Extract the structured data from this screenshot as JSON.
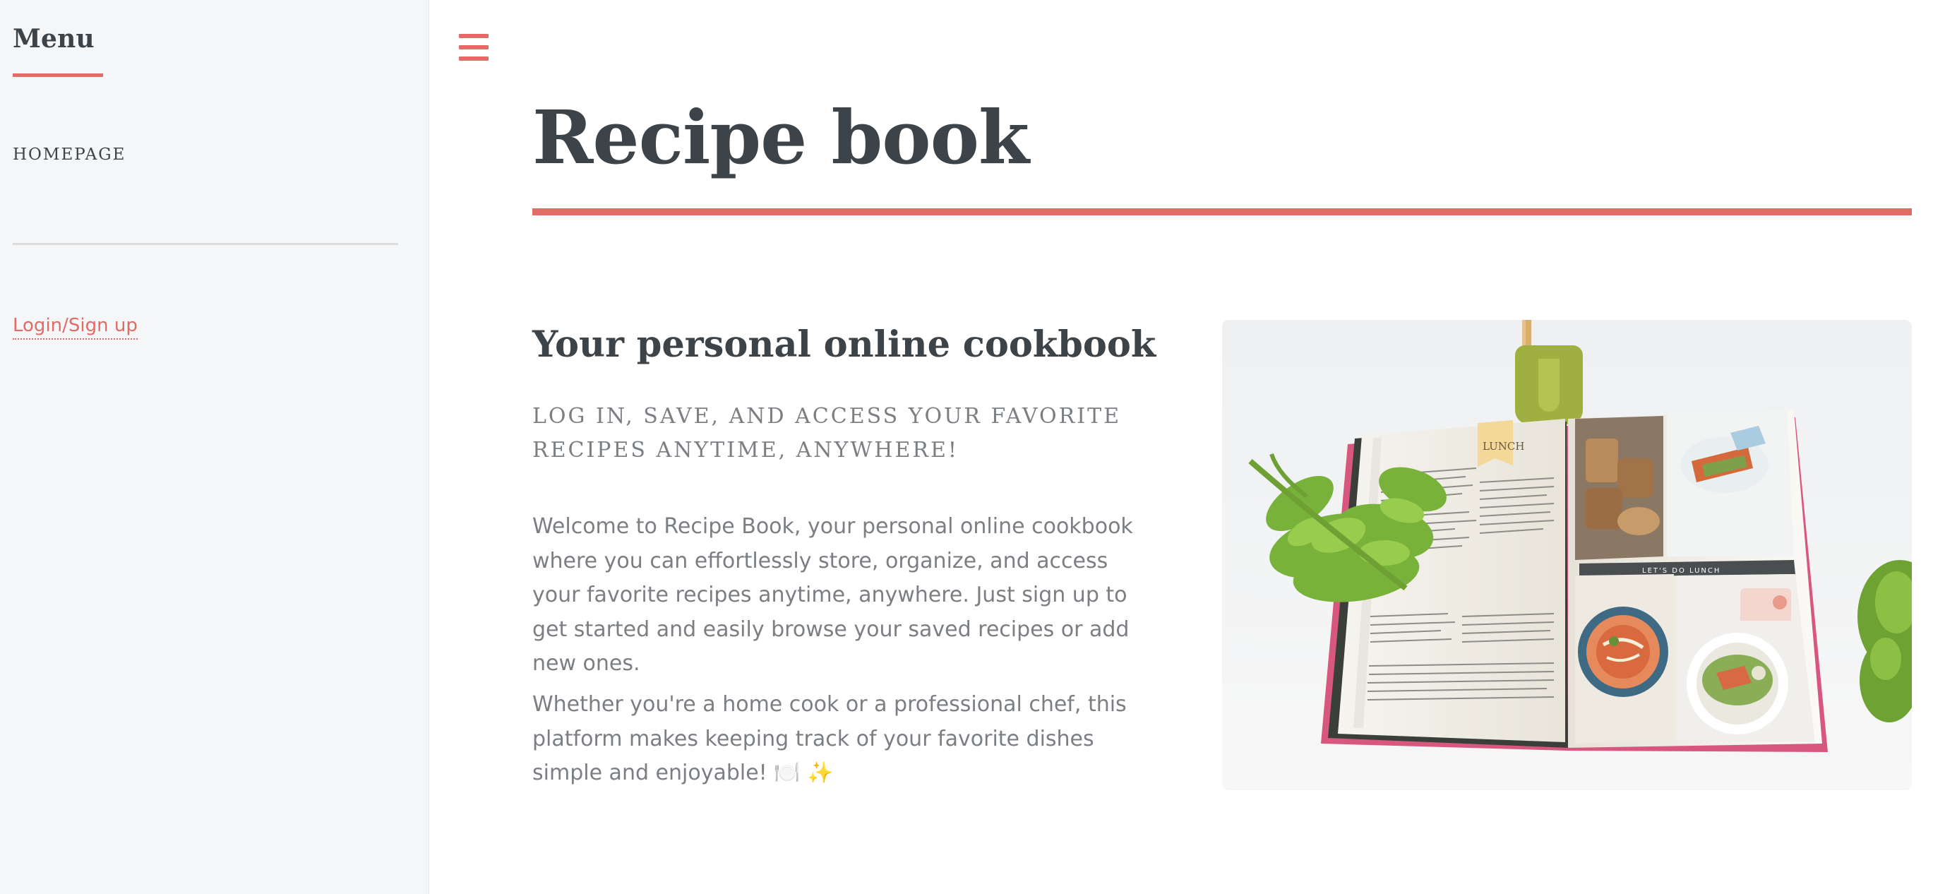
{
  "sidebar": {
    "title": "Menu",
    "nav": [
      {
        "label": "HOMEPAGE"
      }
    ],
    "auth_link": "Login/Sign up"
  },
  "header": {
    "menu_icon": "hamburger-menu-icon"
  },
  "main": {
    "title": "Recipe book",
    "subheading": "Your personal online cookbook",
    "tagline": "LOG IN, SAVE, AND ACCESS YOUR FAVORITE RECIPES ANYTIME, ANYWHERE!",
    "paragraphs": [
      "Welcome to Recipe Book, your personal online cookbook where you can effortlessly store, organize, and access your favorite recipes anytime, anywhere. Just sign up to get started and easily browse your saved recipes or add new ones.",
      "Whether you're a home cook or a professional chef, this platform makes keeping track of your favorite dishes simple and enjoyable! 🍽️ ✨"
    ],
    "image": {
      "label_lunch": "LUNCH",
      "label_lets_do_lunch": "LET'S DO LUNCH"
    }
  },
  "colors": {
    "accent": "#e06c68",
    "heading": "#3d4449",
    "body_text": "#7b7f83",
    "sidebar_bg": "#f5f6f7"
  }
}
